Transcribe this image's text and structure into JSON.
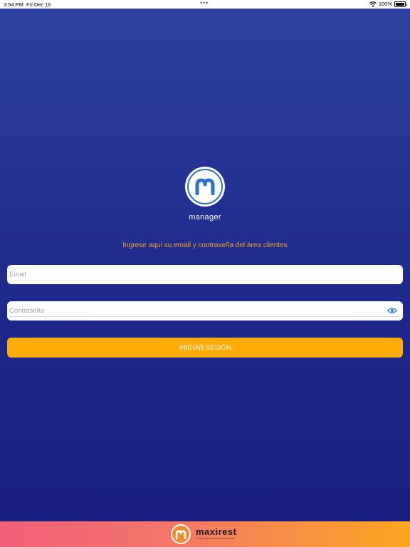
{
  "status_bar": {
    "time": "3:54 PM",
    "date": "Fri Dec 16",
    "dots": "•••",
    "battery": "100%"
  },
  "app": {
    "logo_label": "manager",
    "prompt": "Ingrese aquí su email y contraseña del área clientes"
  },
  "form": {
    "email_placeholder": "Email",
    "password_placeholder": "Contraseña",
    "login_label": "INICIAR SESIÓN"
  },
  "footer": {
    "brand": "maxirest",
    "tagline": "el sistema gastronómico N1 en Argentina"
  },
  "colors": {
    "accent": "#ffac06",
    "prompt_text": "#f7a11a",
    "background_top": "#2d41a0",
    "background_bottom": "#191f82",
    "logo_blue": "#2a6fd1"
  },
  "icons": {
    "wifi": "wifi-icon",
    "battery": "battery-icon",
    "password_toggle": "eye-icon",
    "app_logo": "m-logo-icon",
    "brand_logo": "maxirest-logo-icon"
  }
}
